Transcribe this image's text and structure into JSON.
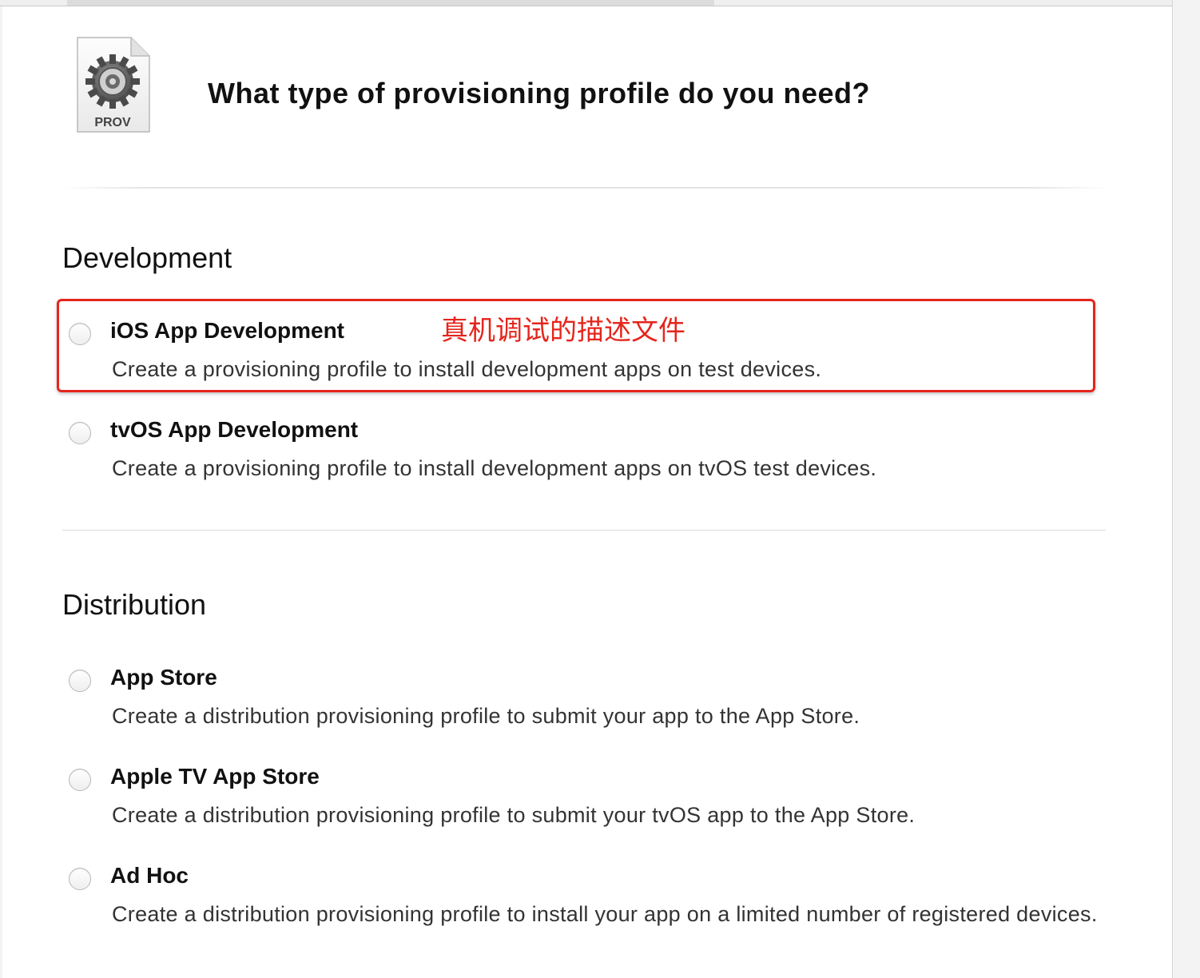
{
  "header": {
    "icon_label": "PROV",
    "title": "What type of provisioning profile do you need?"
  },
  "annotation": {
    "text": "真机调试的描述文件",
    "color": "#e5251c"
  },
  "sections": {
    "development": {
      "heading": "Development",
      "options": [
        {
          "title": "iOS App Development",
          "description": "Create a provisioning profile to install development apps on test devices.",
          "selected": false,
          "highlighted": true
        },
        {
          "title": "tvOS App Development",
          "description": "Create a provisioning profile to install development apps on tvOS test devices.",
          "selected": false
        }
      ]
    },
    "distribution": {
      "heading": "Distribution",
      "options": [
        {
          "title": "App Store",
          "description": "Create a distribution provisioning profile to submit your app to the App Store.",
          "selected": false
        },
        {
          "title": "Apple TV App Store",
          "description": "Create a distribution provisioning profile to submit your tvOS app to the App Store.",
          "selected": false
        },
        {
          "title": "Ad Hoc",
          "description": "Create a distribution provisioning profile to install your app on a limited number of registered devices.",
          "selected": false
        }
      ]
    }
  }
}
